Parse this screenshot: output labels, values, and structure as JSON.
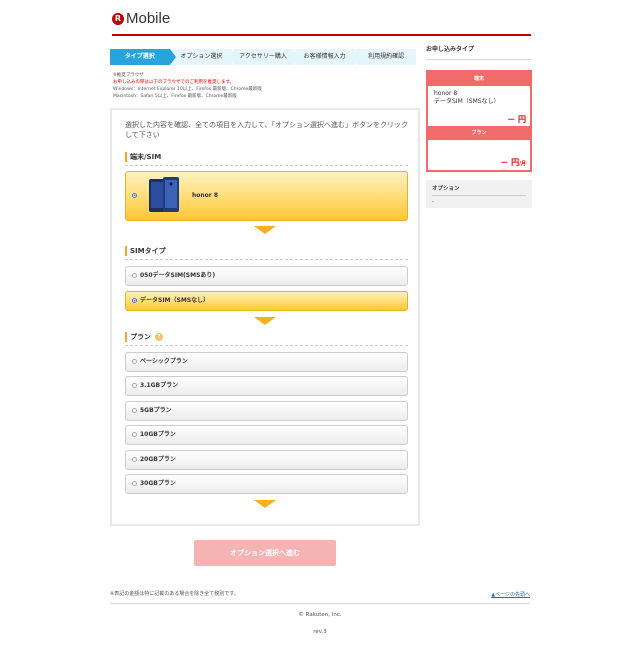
{
  "brand": {
    "logo_letter": "R",
    "logo_text": "Mobile",
    "accent": "#bf0000"
  },
  "steps": [
    "タイプ選択",
    "オプション選択",
    "アクセサリー購入",
    "お客様情報入力",
    "利用規約確認"
  ],
  "browser_notice": {
    "title": "※推奨ブラウザ",
    "warning": "お申し込みの際は以下のブラウザでのご利用を推奨します。",
    "windows": "Windows：Internet Explorer 10以上、Firefox 最新版、Chrome最新版",
    "mac": "Macintosh：Safari 5以上、Firefox 最新版、Chrome最新版"
  },
  "intro": "選択した内容を確認、全ての項目を入力して、「オプション選択へ進む」ボタンをクリックして下さい",
  "sections": {
    "device": {
      "title": "端末/SIM",
      "selected": "honor 8"
    },
    "sim": {
      "title": "SIMタイプ",
      "options": [
        "050データSIM(SMSあり)",
        "データSIM（SMSなし）"
      ],
      "selected_index": 1
    },
    "plan": {
      "title": "プラン",
      "help": "?",
      "options": [
        "ベーシックプラン",
        "3.1GBプラン",
        "5GBプラン",
        "10GBプラン",
        "20GBプラン",
        "30GBプラン"
      ]
    }
  },
  "submit_label": "オプション選択へ進む",
  "sidebar": {
    "title": "お申し込みタイプ",
    "device_header": "端末",
    "device_name": "honor 8",
    "device_sim": "データSIM（SMSなし）",
    "device_price": "－ 円",
    "plan_header": "プラン",
    "plan_price": "－ 円",
    "plan_unit": "/月",
    "option_label": "オプション",
    "option_value": "-"
  },
  "footer": {
    "note": "※表記の金額は特に記載のある場合を除き全て税別です。",
    "pagetop": "▲ページの先頭へ",
    "copyright": "© Rakuten, Inc.",
    "rev": "rev.3"
  }
}
